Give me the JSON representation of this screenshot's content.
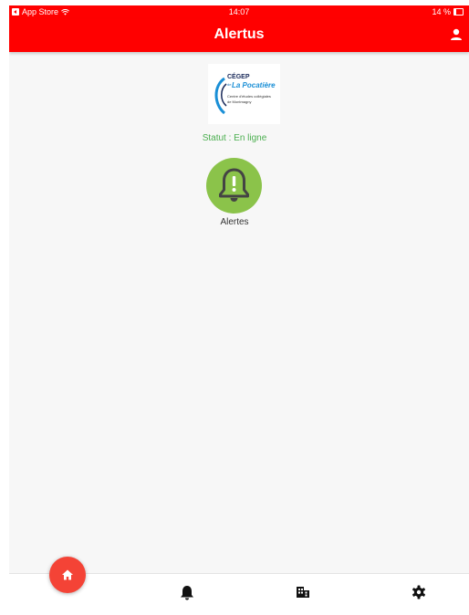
{
  "status_bar": {
    "back_app": "App Store",
    "time": "14:07",
    "battery": "14 %"
  },
  "header": {
    "title": "Alertus",
    "accent_color": "#ff0000"
  },
  "logo": {
    "line1": "CÉGEP",
    "line2_prefix": "de",
    "line2": "La Pocatière",
    "line3": "Centre d'études collégiales",
    "line4": "de Montmagny"
  },
  "status": {
    "text": "Statut : En ligne",
    "color": "#4caf50"
  },
  "alerts_button": {
    "label": "Alertes",
    "icon": "bell-alert-icon",
    "color": "#8bc34a"
  },
  "tab_bar": {
    "home_icon": "home-icon",
    "items": [
      {
        "icon": "bell-icon"
      },
      {
        "icon": "building-icon"
      },
      {
        "icon": "gear-icon"
      }
    ]
  }
}
